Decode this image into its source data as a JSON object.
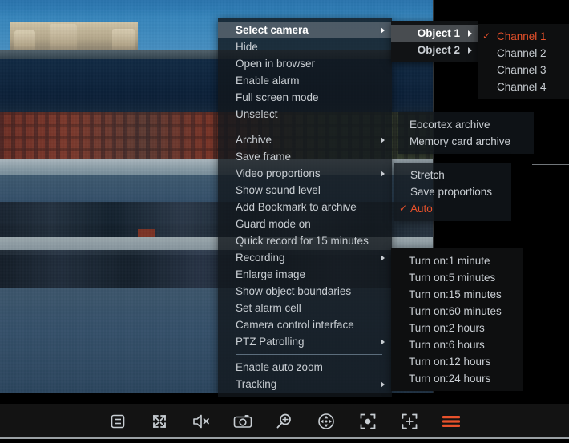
{
  "app": {
    "title": "Eocortex camera context menu",
    "accent_color": "#e8512b",
    "menu_text_color": "#c9ced3"
  },
  "context_menu": {
    "items": [
      {
        "label": "Select camera",
        "submenu": true,
        "selected": true
      },
      {
        "label": "Hide",
        "submenu": false
      },
      {
        "label": "Open in browser",
        "submenu": false
      },
      {
        "label": "Enable alarm",
        "submenu": false
      },
      {
        "label": "Full screen mode",
        "submenu": false
      },
      {
        "label": "Unselect",
        "submenu": false
      },
      {
        "separator": true
      },
      {
        "label": "Archive",
        "submenu": true
      },
      {
        "label": "Save frame",
        "submenu": false
      },
      {
        "label": "Video proportions",
        "submenu": true
      },
      {
        "label": "Show sound level",
        "submenu": false
      },
      {
        "label": "Add Bookmark to archive",
        "submenu": false
      },
      {
        "label": "Guard mode on",
        "submenu": false
      },
      {
        "label": "Quick record for 15 minutes",
        "submenu": false
      },
      {
        "label": "Recording",
        "submenu": true
      },
      {
        "label": "Enlarge image",
        "submenu": false
      },
      {
        "label": "Show object boundaries",
        "submenu": false
      },
      {
        "label": "Set alarm cell",
        "submenu": false
      },
      {
        "label": "Camera control interface",
        "submenu": false
      },
      {
        "label": "PTZ Patrolling",
        "submenu": true
      },
      {
        "separator": true
      },
      {
        "label": "Enable auto zoom",
        "submenu": false
      },
      {
        "label": "Tracking",
        "submenu": true
      }
    ]
  },
  "object_menu": {
    "items": [
      {
        "label": "Object 1",
        "submenu": true,
        "selected": true
      },
      {
        "label": "Object 2",
        "submenu": true
      }
    ]
  },
  "channel_menu": {
    "checkmark": "✓",
    "items": [
      {
        "label": "Channel 1",
        "checked": true
      },
      {
        "label": "Channel 2",
        "checked": false
      },
      {
        "label": "Channel 3",
        "checked": false
      },
      {
        "label": "Channel 4",
        "checked": false
      }
    ]
  },
  "archive_menu": {
    "items": [
      {
        "label": "Eocortex archive"
      },
      {
        "label": "Memory card archive"
      }
    ]
  },
  "proportions_menu": {
    "checkmark": "✓",
    "items": [
      {
        "label": "Stretch",
        "checked": false
      },
      {
        "label": "Save proportions",
        "checked": false
      },
      {
        "label": "Auto",
        "checked": true
      }
    ]
  },
  "recording_menu": {
    "items": [
      {
        "label": "Turn on:1 minute"
      },
      {
        "label": "Turn on:5 minutes"
      },
      {
        "label": "Turn on:15 minutes"
      },
      {
        "label": "Turn on:60 minutes"
      },
      {
        "label": "Turn on:2 hours"
      },
      {
        "label": "Turn on:6 hours"
      },
      {
        "label": "Turn on:12 hours"
      },
      {
        "label": "Turn on:24 hours"
      }
    ]
  },
  "toolbar": {
    "buttons": [
      {
        "name": "archive-panel-icon",
        "title": "Archive panel"
      },
      {
        "name": "fullscreen-icon",
        "title": "Full screen"
      },
      {
        "name": "sound-mute-icon",
        "title": "Sound off"
      },
      {
        "name": "snapshot-camera-icon",
        "title": "Save frame"
      },
      {
        "name": "zoom-in-magnifier-icon",
        "title": "Zoom"
      },
      {
        "name": "ptz-control-icon",
        "title": "PTZ control"
      },
      {
        "name": "focus-point-icon",
        "title": "Focus point"
      },
      {
        "name": "add-point-icon",
        "title": "Add point"
      },
      {
        "name": "menu-hamburger-icon",
        "title": "Menu"
      }
    ]
  }
}
